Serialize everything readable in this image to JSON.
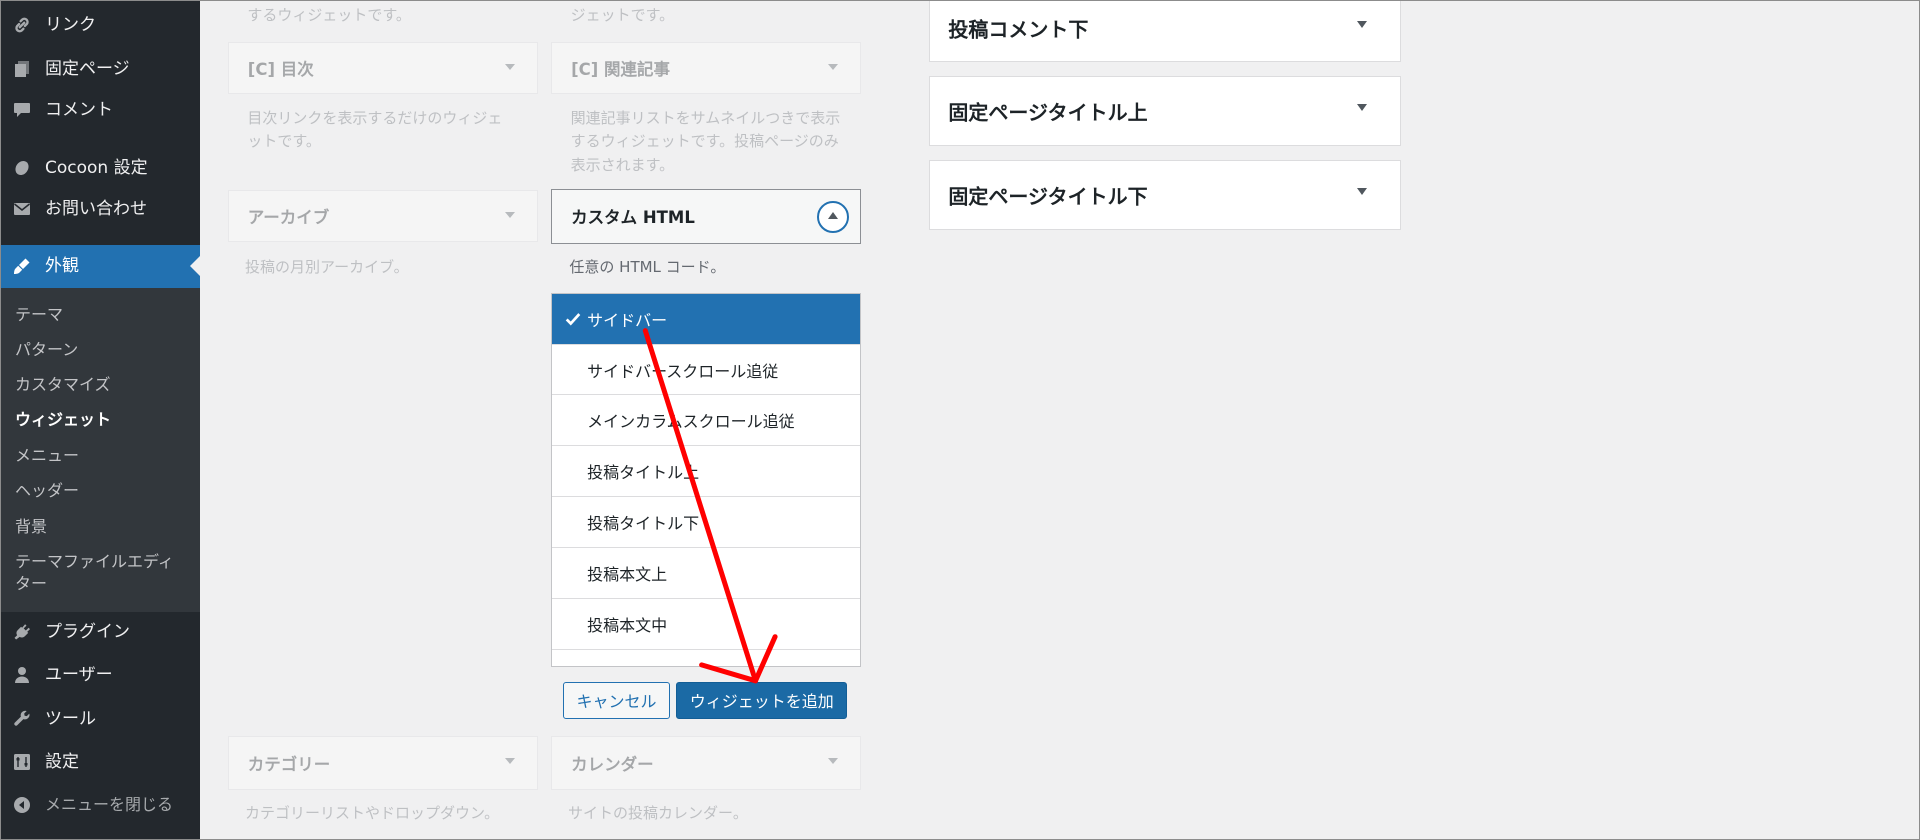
{
  "sidebar": {
    "top_items": [
      {
        "label": "リンク",
        "icon": "link-icon"
      },
      {
        "label": "固定ページ",
        "icon": "pages-icon"
      },
      {
        "label": "コメント",
        "icon": "comments-icon"
      },
      {
        "label": "Cocoon 設定",
        "icon": "cocoon-icon"
      },
      {
        "label": "お問い合わせ",
        "icon": "mail-icon"
      }
    ],
    "active_item": {
      "label": "外観",
      "icon": "appearance-icon"
    },
    "submenu": [
      {
        "label": "テーマ"
      },
      {
        "label": "パターン"
      },
      {
        "label": "カスタマイズ"
      },
      {
        "label": "ウィジェット",
        "current": true
      },
      {
        "label": "メニュー"
      },
      {
        "label": "ヘッダー"
      },
      {
        "label": "背景"
      },
      {
        "label": "テーマファイルエディター"
      }
    ],
    "bottom_items": [
      {
        "label": "プラグイン",
        "icon": "plugins-icon"
      },
      {
        "label": "ユーザー",
        "icon": "users-icon"
      },
      {
        "label": "ツール",
        "icon": "tools-icon"
      },
      {
        "label": "設定",
        "icon": "settings-icon"
      }
    ],
    "collapse": {
      "label": "メニューを閉じる",
      "icon": "collapse-menu-icon"
    }
  },
  "available_widgets": {
    "partial_descriptions": [
      "するウィジェットです。",
      "ジェットです。"
    ],
    "widgets": [
      {
        "title": "[C] 目次",
        "description": "目次リンクを表示するだけのウィジェットです。"
      },
      {
        "title": "[C] 関連記事",
        "description": "関連記事リストをサムネイルつきで表示するウィジェットです。投稿ページのみ表示されます。"
      },
      {
        "title": "アーカイブ",
        "description": "投稿の月別アーカイブ。"
      },
      {
        "title": "カテゴリー",
        "description": "カテゴリーリストやドロップダウン。"
      },
      {
        "title": "カレンダー",
        "description": "サイトの投稿カレンダー。"
      }
    ],
    "active_widget": {
      "title": "カスタム HTML",
      "description": "任意の HTML コード。",
      "area_options": [
        "サイドバー",
        "サイドバースクロール追従",
        "メインカラムスクロール追従",
        "投稿タイトル上",
        "投稿タイトル下",
        "投稿本文上",
        "投稿本文中"
      ],
      "selected_index": 0,
      "cancel_label": "キャンセル",
      "add_label": "ウィジェットを追加"
    }
  },
  "widget_areas": [
    {
      "title": "投稿コメント下"
    },
    {
      "title": "固定ページタイトル上"
    },
    {
      "title": "固定ページタイトル下"
    }
  ],
  "colors": {
    "sidebar": "#23282d",
    "accent": "#2271b1",
    "annotation": "#ff0000"
  }
}
